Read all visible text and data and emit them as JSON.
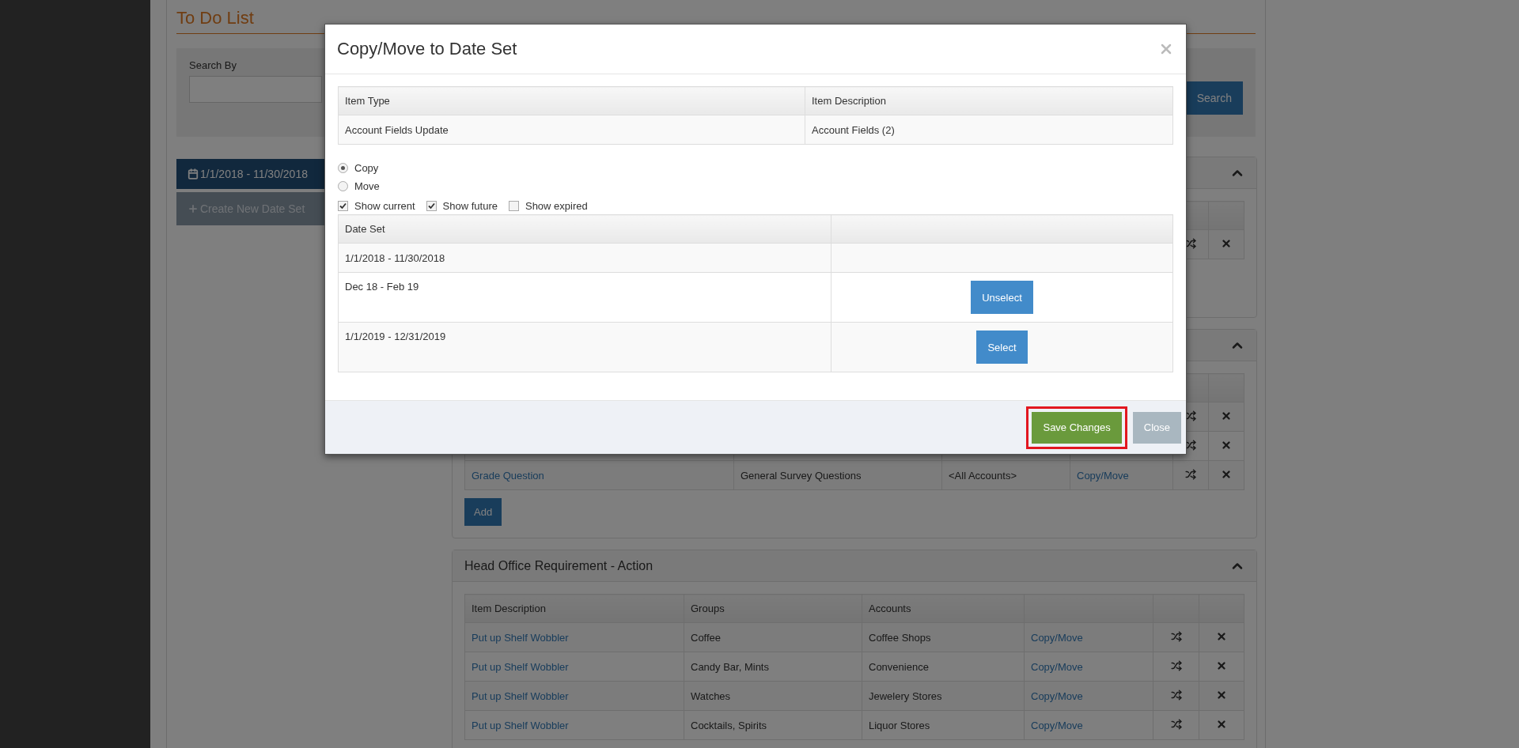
{
  "page": {
    "title": "To Do List",
    "search": {
      "label": "Search By",
      "button": "Search"
    },
    "sidebar": [
      {
        "kind": "date_set",
        "label": "1/1/2018 - 11/30/2018"
      },
      {
        "kind": "create",
        "label": "Create New Date Set"
      }
    ],
    "panels": [
      {
        "expanded": true,
        "rows": [
          {}
        ]
      },
      {
        "expanded": true,
        "rows": [
          {},
          {},
          {
            "item": "Grade Question",
            "group": "General Survey Questions",
            "account": "<All Accounts>",
            "action": "Copy/Move"
          }
        ],
        "add_button": "Add"
      },
      {
        "expanded": true,
        "title": "Head Office Requirement - Action",
        "columns": [
          "Item Description",
          "Groups",
          "Accounts"
        ],
        "rows": [
          {
            "item": "Put up Shelf Wobbler",
            "group": "Coffee",
            "account": "Coffee Shops",
            "action": "Copy/Move"
          },
          {
            "item": "Put up Shelf Wobbler",
            "group": "Candy Bar, Mints",
            "account": "Convenience",
            "action": "Copy/Move"
          },
          {
            "item": "Put up Shelf Wobbler",
            "group": "Watches",
            "account": "Jewelery Stores",
            "action": "Copy/Move"
          },
          {
            "item": "Put up Shelf Wobbler",
            "group": "Cocktails, Spirits",
            "account": "Liquor Stores",
            "action": "Copy/Move"
          }
        ]
      }
    ]
  },
  "modal": {
    "title": "Copy/Move to Date Set",
    "item_table": {
      "columns": [
        "Item Type",
        "Item Description"
      ],
      "rows": [
        [
          "Account Fields Update",
          "Account Fields (2)"
        ]
      ]
    },
    "modes": [
      {
        "label": "Copy",
        "selected": true
      },
      {
        "label": "Move",
        "selected": false
      }
    ],
    "filters": [
      {
        "label": "Show current",
        "checked": true
      },
      {
        "label": "Show future",
        "checked": true
      },
      {
        "label": "Show expired",
        "checked": false
      }
    ],
    "date_sets": {
      "columns": [
        "Date Set"
      ],
      "rows": [
        {
          "label": "1/1/2018 - 11/30/2018"
        },
        {
          "label": "Dec 18 - Feb 19",
          "action": "Unselect"
        },
        {
          "label": "1/1/2019 - 12/31/2019",
          "action": "Select"
        }
      ]
    },
    "buttons": [
      {
        "label": "Save Changes",
        "kind": "primary",
        "highlighted": true
      },
      {
        "label": "Close",
        "kind": "secondary",
        "highlighted": false
      }
    ]
  }
}
